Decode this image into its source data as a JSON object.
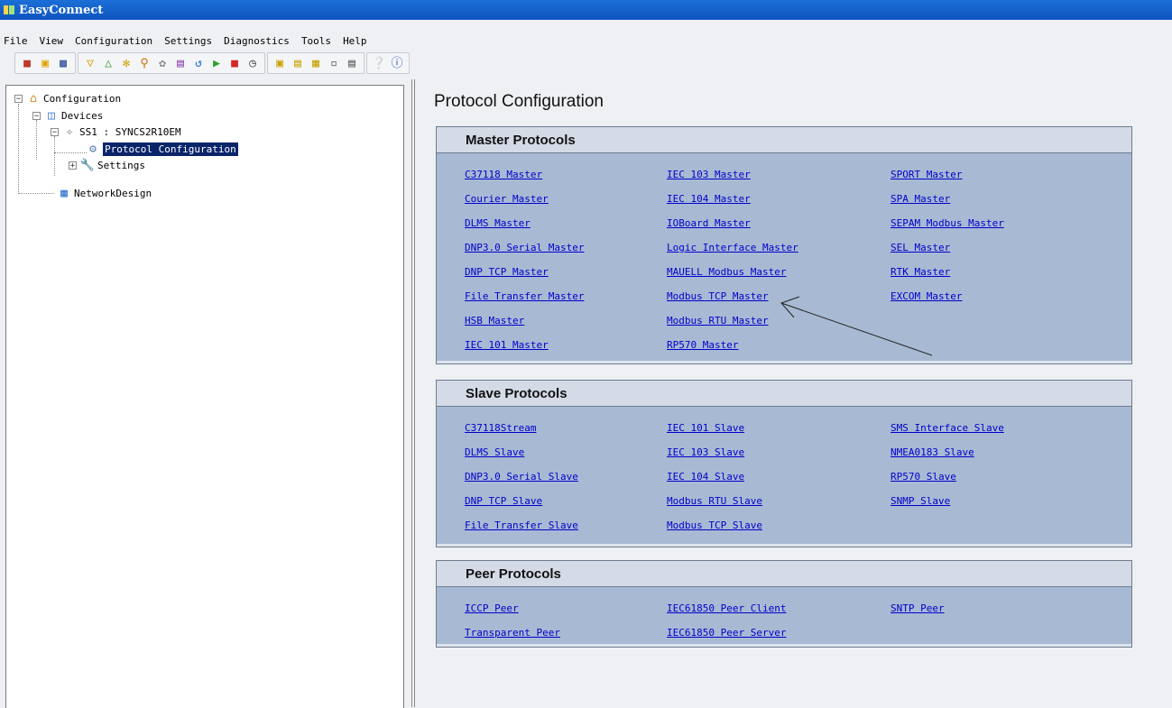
{
  "window": {
    "title": "EasyConnect"
  },
  "menu": [
    "File",
    "View",
    "Configuration",
    "Settings",
    "Diagnostics",
    "Tools",
    "Help"
  ],
  "toolbar": {
    "groups": [
      [
        "new-icon",
        "open-icon",
        "save-icon"
      ],
      [
        "triangle-down-icon",
        "triangle-up-icon",
        "refresh-icon",
        "find-icon",
        "tag-icon",
        "list-icon",
        "connect-icon",
        "play-icon",
        "stop-icon",
        "clock-icon"
      ],
      [
        "monitor-icon",
        "document-icon",
        "tree-icon",
        "page-icon",
        "print-icon"
      ],
      [
        "help-icon",
        "about-icon"
      ]
    ]
  },
  "tree": {
    "root": "Configuration",
    "devices": "Devices",
    "device": "SS1 : SYNCS2R10EM",
    "protocol_config": "Protocol Configuration",
    "settings": "Settings",
    "network": "NetworkDesign"
  },
  "main": {
    "title": "Protocol Configuration",
    "master": {
      "header": "Master Protocols",
      "columns": [
        [
          "C37118 Master",
          "Courier Master",
          "DLMS Master",
          "DNP3.0 Serial Master",
          "DNP TCP Master",
          "File Transfer Master",
          "HSB Master",
          "IEC 101 Master"
        ],
        [
          "IEC 103 Master",
          "IEC 104 Master",
          "IOBoard Master",
          "Logic Interface Master",
          "MAUELL Modbus Master",
          "Modbus TCP Master",
          "Modbus RTU Master",
          "RP570 Master"
        ],
        [
          "SPORT Master",
          "SPA Master",
          "SEPAM Modbus Master",
          "SEL Master",
          "RTK Master",
          "EXCOM Master"
        ]
      ]
    },
    "slave": {
      "header": "Slave Protocols",
      "columns": [
        [
          "C37118Stream",
          "DLMS Slave",
          "DNP3.0 Serial Slave",
          "DNP TCP Slave",
          "File Transfer Slave"
        ],
        [
          "IEC 101 Slave",
          "IEC 103 Slave",
          "IEC 104 Slave",
          "Modbus RTU Slave",
          "Modbus TCP Slave"
        ],
        [
          "SMS Interface Slave",
          "NMEA0183 Slave",
          "RP570 Slave",
          "SNMP Slave"
        ]
      ]
    },
    "peer": {
      "header": "Peer Protocols",
      "columns": [
        [
          "ICCP Peer",
          "Transparent Peer"
        ],
        [
          "IEC61850 Peer Client",
          "IEC61850 Peer Server"
        ],
        [
          "SNTP Peer"
        ]
      ]
    }
  }
}
